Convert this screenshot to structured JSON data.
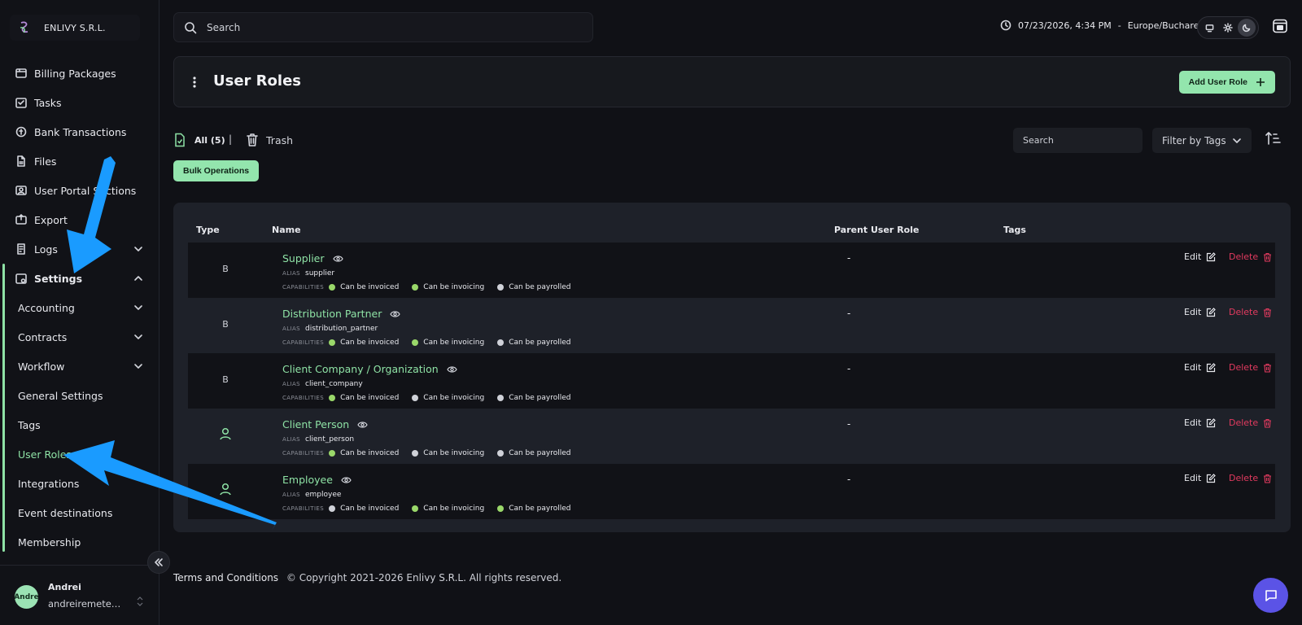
{
  "org": {
    "name": "ENLIVY S.R.L."
  },
  "nav": {
    "items": [
      {
        "label": "Billing Packages",
        "icon": "package-icon"
      },
      {
        "label": "Tasks",
        "icon": "tasks-icon"
      },
      {
        "label": "Bank Transactions",
        "icon": "bank-icon"
      },
      {
        "label": "Files",
        "icon": "file-icon"
      },
      {
        "label": "User Portal Sections",
        "icon": "portal-icon"
      },
      {
        "label": "Export",
        "icon": "export-icon"
      },
      {
        "label": "Logs",
        "icon": "logs-icon"
      }
    ],
    "settings": "Settings",
    "sub": [
      {
        "label": "Accounting"
      },
      {
        "label": "Contracts"
      },
      {
        "label": "Workflow"
      },
      {
        "label": "General Settings"
      },
      {
        "label": "Tags"
      },
      {
        "label": "User Roles"
      },
      {
        "label": "Integrations"
      },
      {
        "label": "Event destinations"
      },
      {
        "label": "Membership"
      }
    ]
  },
  "user": {
    "name": "Andrei",
    "initials": "Andre",
    "email": "andreiremeteanu@"
  },
  "topbar": {
    "search_placeholder": "Search",
    "datetime": "07/23/2026, 4:34 PM",
    "dash": "-",
    "timezone": "Europe/Bucharest"
  },
  "page": {
    "title": "User Roles",
    "add_label": "Add User Role"
  },
  "filters": {
    "all": "All (5)",
    "sep": "|",
    "trash": "Trash",
    "search_placeholder": "Search",
    "tags": "Filter by Tags",
    "bulk": "Bulk Operations"
  },
  "table": {
    "headers": {
      "type": "Type",
      "name": "Name",
      "parent": "Parent User Role",
      "tags": "Tags"
    },
    "alias_label": "ALIAS",
    "capabilities_label": "CAPABILITIES",
    "edit_label": "Edit",
    "delete_label": "Delete",
    "rows": [
      {
        "type": "B",
        "name": "Supplier",
        "alias": "supplier",
        "parent": "-",
        "caps": [
          {
            "label": "Can be invoiced",
            "on": true
          },
          {
            "label": "Can be invoicing",
            "on": true
          },
          {
            "label": "Can be payrolled",
            "on": false
          }
        ]
      },
      {
        "type": "B",
        "name": "Distribution Partner",
        "alias": "distribution_partner",
        "parent": "-",
        "caps": [
          {
            "label": "Can be invoiced",
            "on": true
          },
          {
            "label": "Can be invoicing",
            "on": true
          },
          {
            "label": "Can be payrolled",
            "on": false
          }
        ]
      },
      {
        "type": "B",
        "name": "Client Company / Organization",
        "alias": "client_company",
        "parent": "-",
        "caps": [
          {
            "label": "Can be invoiced",
            "on": true
          },
          {
            "label": "Can be invoicing",
            "on": false
          },
          {
            "label": "Can be payrolled",
            "on": false
          }
        ]
      },
      {
        "type": "person-icon",
        "name": "Client Person",
        "alias": "client_person",
        "parent": "-",
        "caps": [
          {
            "label": "Can be invoiced",
            "on": true
          },
          {
            "label": "Can be invoicing",
            "on": false
          },
          {
            "label": "Can be payrolled",
            "on": false
          }
        ]
      },
      {
        "type": "person-icon",
        "name": "Employee",
        "alias": "employee",
        "parent": "-",
        "caps": [
          {
            "label": "Can be invoiced",
            "on": false
          },
          {
            "label": "Can be invoicing",
            "on": true
          },
          {
            "label": "Can be payrolled",
            "on": true
          }
        ]
      }
    ]
  },
  "footer": {
    "terms": "Terms and Conditions",
    "copyright": "© Copyright 2021-2026 Enlivy S.R.L. All rights reserved."
  },
  "colors": {
    "accent": "#8ee2a5",
    "danger": "#e23a5f",
    "cap_on": "#9ad86a",
    "cap_off": "#cfd1d8",
    "chat": "#5b53e6",
    "annotation": "#1a9bff"
  }
}
